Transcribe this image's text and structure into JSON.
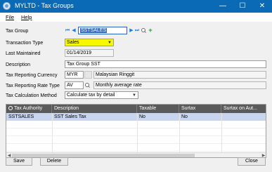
{
  "window": {
    "title": "MYLTD - Tax Groups",
    "minimize_glyph": "—",
    "maximize_glyph": "☐",
    "close_glyph": "✕"
  },
  "menu": {
    "file": "File",
    "help": "Help"
  },
  "form": {
    "tax_group_label": "Tax Group",
    "tax_group_value": "SSTSALES",
    "transaction_type_label": "Transaction Type",
    "transaction_type_value": "Sales",
    "last_maintained_label": "Last Maintained",
    "last_maintained_value": "01/14/2019",
    "description_label": "Description",
    "description_value": "Tax Group SST",
    "currency_label": "Tax Reporting Currency",
    "currency_code": "MYR",
    "currency_name": "Malaysian Ringgit",
    "rate_type_label": "Tax Reporting Rate Type",
    "rate_type_code": "AV",
    "rate_type_name": "Monthly average rate",
    "calc_method_label": "Tax Calculation Method",
    "calc_method_value": "Calculate tax by detail"
  },
  "nav_icons": {
    "first": "⏮",
    "prev": "◀",
    "next": "▶",
    "last": "⏭",
    "new": "+"
  },
  "grid": {
    "columns": [
      "Tax Authority",
      "Description",
      "Taxable",
      "Surtax",
      "Surtax on Aut..."
    ],
    "rows": [
      {
        "tax_authority": "SSTSALES",
        "description": "SST Sales Tax",
        "taxable": "No",
        "surtax": "No",
        "surtax_on_auth": ""
      }
    ]
  },
  "buttons": {
    "save": "Save",
    "delete": "Delete",
    "close": "Close"
  },
  "colors": {
    "titlebar": "#0b6ab5",
    "selection": "#316ac5",
    "required_field": "#f7f700",
    "grid_header": "#5a5a5a",
    "selected_row": "#c8d5ef"
  }
}
